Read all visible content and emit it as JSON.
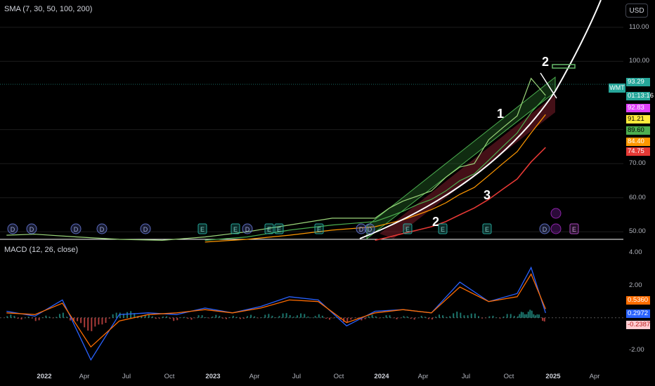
{
  "main_pane": {
    "indicator_title": "SMA (7, 30, 50, 100, 200)",
    "currency_button": "USD"
  },
  "macd_pane": {
    "indicator_title": "MACD (12, 26, close)"
  },
  "colors": {
    "background": "#000000",
    "price_line": "#9bd67a",
    "channel_fill": "#2e7d32",
    "sma7": "#e040fb",
    "sma30": "#ffeb3b",
    "sma50": "#4caf50",
    "sma100": "#ff9800",
    "sma200": "#e53935",
    "macd_line": "#2962ff",
    "signal_line": "#ff6d00",
    "annotation": "#ffffff"
  },
  "chart_data": [
    {
      "type": "line",
      "title": "SMA (7, 30, 50, 100, 200)",
      "symbol": "WMT",
      "y_scale": {
        "ylim": [
          48,
          118
        ],
        "ticks": [
          "110.00",
          "100.00",
          "80.00",
          "70.00",
          "60.00",
          "50.00"
        ]
      },
      "x_ticks": [
        "2022",
        "Apr",
        "Jul",
        "Oct",
        "2023",
        "Apr",
        "Jul",
        "Oct",
        "2024",
        "Apr",
        "Jul",
        "Oct",
        "2025",
        "Apr"
      ],
      "x_ticks_bold": [
        "2022",
        "2023",
        "2024",
        "2025"
      ],
      "x": [
        "2021-11",
        "2022-01",
        "2022-04",
        "2022-07",
        "2022-10",
        "2023-01",
        "2023-04",
        "2023-07",
        "2023-10",
        "2024-01",
        "2024-02",
        "2024-03",
        "2024-04",
        "2024-05",
        "2024-06",
        "2024-07",
        "2024-08",
        "2024-09",
        "2024-10",
        "2024-11",
        "2024-12",
        "2025-01"
      ],
      "series": [
        {
          "values": [
            49.0,
            49.3,
            48.5,
            47.8,
            47.5,
            48.5,
            50.0,
            52.0,
            54.0,
            54.0,
            57.0,
            59.0,
            60.5,
            62.0,
            66.0,
            69.0,
            70.0,
            77.0,
            80.5,
            84.0,
            95.0,
            90.0
          ]
        },
        {
          "values": [
            null,
            null,
            null,
            null,
            null,
            null,
            null,
            null,
            null,
            null,
            null,
            null,
            null,
            null,
            null,
            null,
            null,
            null,
            null,
            null,
            null,
            92.83
          ]
        },
        {
          "values": [
            null,
            null,
            null,
            null,
            null,
            null,
            null,
            null,
            null,
            null,
            null,
            null,
            null,
            null,
            null,
            null,
            null,
            null,
            null,
            null,
            null,
            91.21
          ]
        },
        {
          "values": [
            null,
            null,
            null,
            null,
            null,
            47.5,
            48.5,
            50.5,
            52.0,
            53.0,
            54.5,
            56.0,
            58.0,
            59.5,
            62.0,
            65.0,
            67.0,
            71.0,
            75.0,
            79.0,
            85.0,
            89.6
          ]
        },
        {
          "values": [
            null,
            null,
            null,
            null,
            null,
            47.0,
            47.8,
            49.0,
            50.5,
            51.5,
            52.5,
            53.5,
            55.0,
            56.5,
            58.5,
            61.0,
            63.0,
            66.5,
            70.0,
            73.5,
            79.0,
            84.4
          ]
        },
        {
          "values": [
            null,
            null,
            null,
            null,
            null,
            null,
            null,
            null,
            null,
            47.5,
            48.5,
            49.5,
            50.5,
            51.5,
            53.0,
            55.0,
            57.0,
            59.5,
            62.5,
            65.5,
            70.5,
            74.75
          ]
        }
      ],
      "price_labels": [
        {
          "text": "93.29",
          "color": "#26a69a"
        },
        {
          "text": "01:13:16",
          "color": "#26a69a"
        },
        {
          "text": "92.83",
          "color": "#e040fb"
        },
        {
          "text": "91.21",
          "color": "#ffeb3b"
        },
        {
          "text": "89.60",
          "color": "#4caf50"
        },
        {
          "text": "84.40",
          "color": "#ff9800"
        },
        {
          "text": "74.75",
          "color": "#e53935"
        }
      ],
      "annotations": [
        "1",
        "2",
        "3",
        "2"
      ],
      "event_markers": [
        "D",
        "D",
        "D",
        "D",
        "D",
        "E",
        "E",
        "D",
        "E",
        "E",
        "E",
        "D",
        "D",
        "E",
        "E",
        "E",
        "D",
        "E"
      ]
    },
    {
      "type": "bar",
      "title": "MACD (12, 26, close)",
      "y_scale": {
        "ylim": [
          -3.0,
          4.8
        ],
        "ticks": [
          "4.00",
          "2.00",
          "-2.00"
        ]
      },
      "x": [
        "2021-11",
        "2022-01",
        "2022-03",
        "2022-05",
        "2022-07",
        "2022-09",
        "2022-11",
        "2023-01",
        "2023-03",
        "2023-05",
        "2023-07",
        "2023-09",
        "2023-11",
        "2024-01",
        "2024-03",
        "2024-05",
        "2024-07",
        "2024-09",
        "2024-11",
        "2024-12",
        "2025-01"
      ],
      "series": [
        {
          "name": "MACD",
          "values": [
            0.4,
            0.1,
            1.1,
            -2.6,
            0.2,
            0.3,
            0.2,
            0.6,
            0.3,
            0.7,
            1.3,
            1.1,
            -0.5,
            0.4,
            0.5,
            0.3,
            2.2,
            1.0,
            1.5,
            3.1,
            0.2972
          ]
        },
        {
          "name": "Signal",
          "values": [
            0.3,
            0.2,
            0.9,
            -1.8,
            -0.2,
            0.2,
            0.3,
            0.5,
            0.3,
            0.6,
            1.1,
            1.0,
            -0.3,
            0.3,
            0.5,
            0.3,
            1.9,
            1.0,
            1.3,
            2.7,
            0.536
          ]
        },
        {
          "name": "Histogram",
          "values": [
            0.1,
            -0.1,
            0.2,
            -0.8,
            0.4,
            0.1,
            -0.1,
            0.1,
            0.0,
            0.1,
            0.2,
            0.1,
            -0.2,
            0.1,
            0.0,
            0.0,
            0.3,
            0.0,
            0.2,
            0.4,
            -0.2387
          ]
        }
      ],
      "value_labels": [
        {
          "text": "0.5360",
          "color": "#ff6d00"
        },
        {
          "text": "0.2972",
          "color": "#2962ff"
        },
        {
          "text": "-0.2387",
          "color": "#ef9a9a"
        }
      ]
    }
  ]
}
